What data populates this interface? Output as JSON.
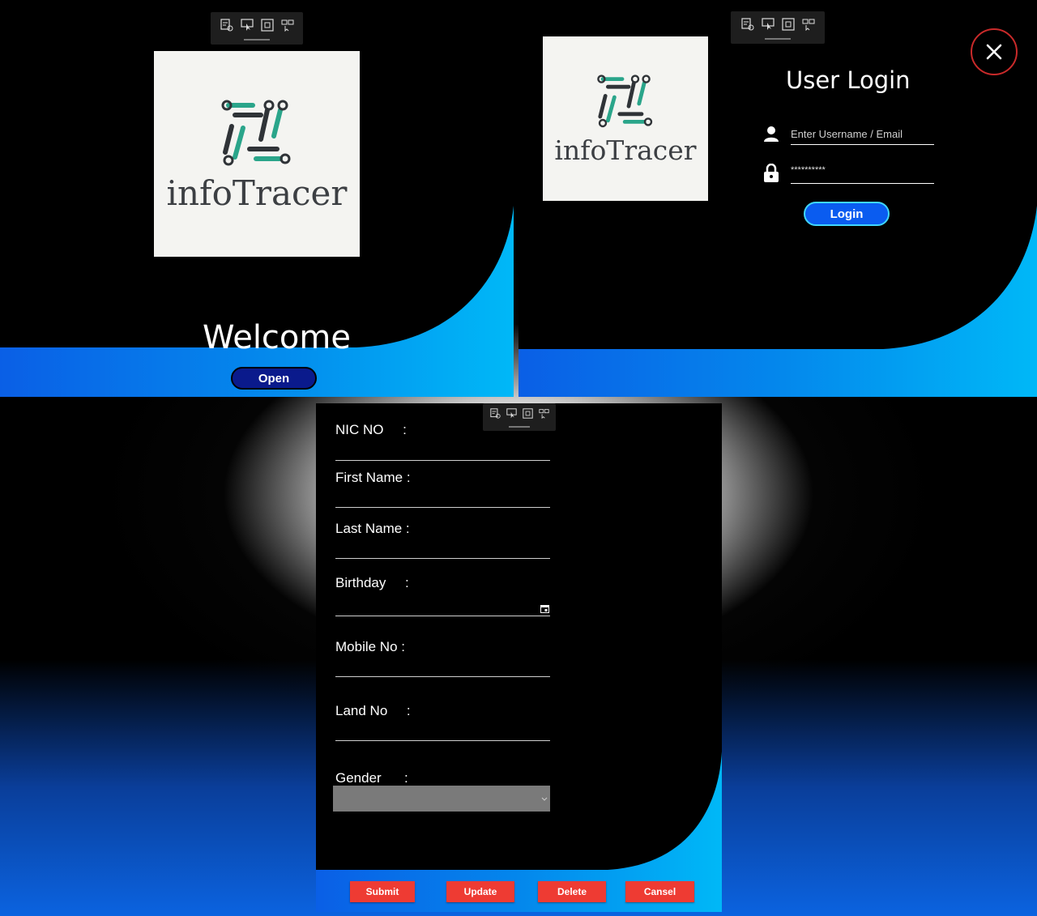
{
  "welcome_screen": {
    "logo_text": "infoTracer",
    "heading": "Welcome",
    "open_button": "Open"
  },
  "login_screen": {
    "logo_text": "infoTracer",
    "title": "User Login",
    "username_placeholder": "Enter Username / Email",
    "password_value": "**********",
    "login_button": "Login",
    "close_icon": "close-icon"
  },
  "registration_form": {
    "fields": [
      {
        "label": "NIC NO     :"
      },
      {
        "label": "First Name :"
      },
      {
        "label": "Last Name :"
      },
      {
        "label": "Birthday     :"
      },
      {
        "label": "Mobile No :"
      },
      {
        "label": "Land No     :"
      },
      {
        "label": "Gender      :"
      }
    ],
    "buttons": {
      "submit": "Submit",
      "update": "Update",
      "delete": "Delete",
      "cancel": "Cansel"
    }
  },
  "toolbar_icons": [
    "select-element-icon",
    "pointer-icon",
    "track-focus-icon",
    "display-layout-icon"
  ],
  "colors": {
    "accent_blue": "#00b4f5",
    "button_navy": "#0a1a8c",
    "login_button": "#0a5cf0",
    "danger_red": "#ee3b33",
    "logo_teal": "#2aa58a",
    "logo_dark": "#2f3337"
  }
}
